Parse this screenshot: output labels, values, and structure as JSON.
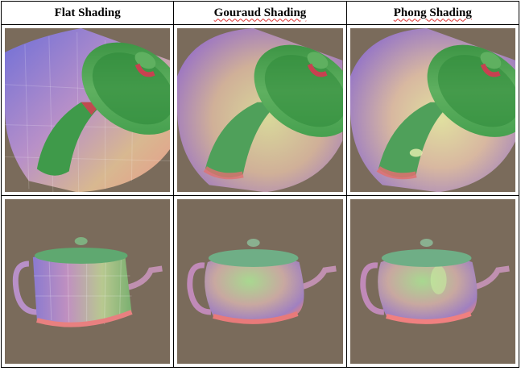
{
  "columns": [
    {
      "label": "Flat Shading",
      "spell_flag": false
    },
    {
      "label": "Gouraud Shading",
      "spell_flag": true
    },
    {
      "label": "Phong Shading",
      "spell_flag": true
    }
  ],
  "rows": [
    {
      "view": "close-up",
      "renders": [
        "teapot-flat-closeup",
        "teapot-gouraud-closeup",
        "teapot-phong-closeup"
      ]
    },
    {
      "view": "full",
      "renders": [
        "teapot-flat-full",
        "teapot-gouraud-full",
        "teapot-phong-full"
      ]
    }
  ],
  "colors": {
    "background": "#7a6b5b",
    "border": "#000000",
    "spell_underline": "#dd3333"
  }
}
